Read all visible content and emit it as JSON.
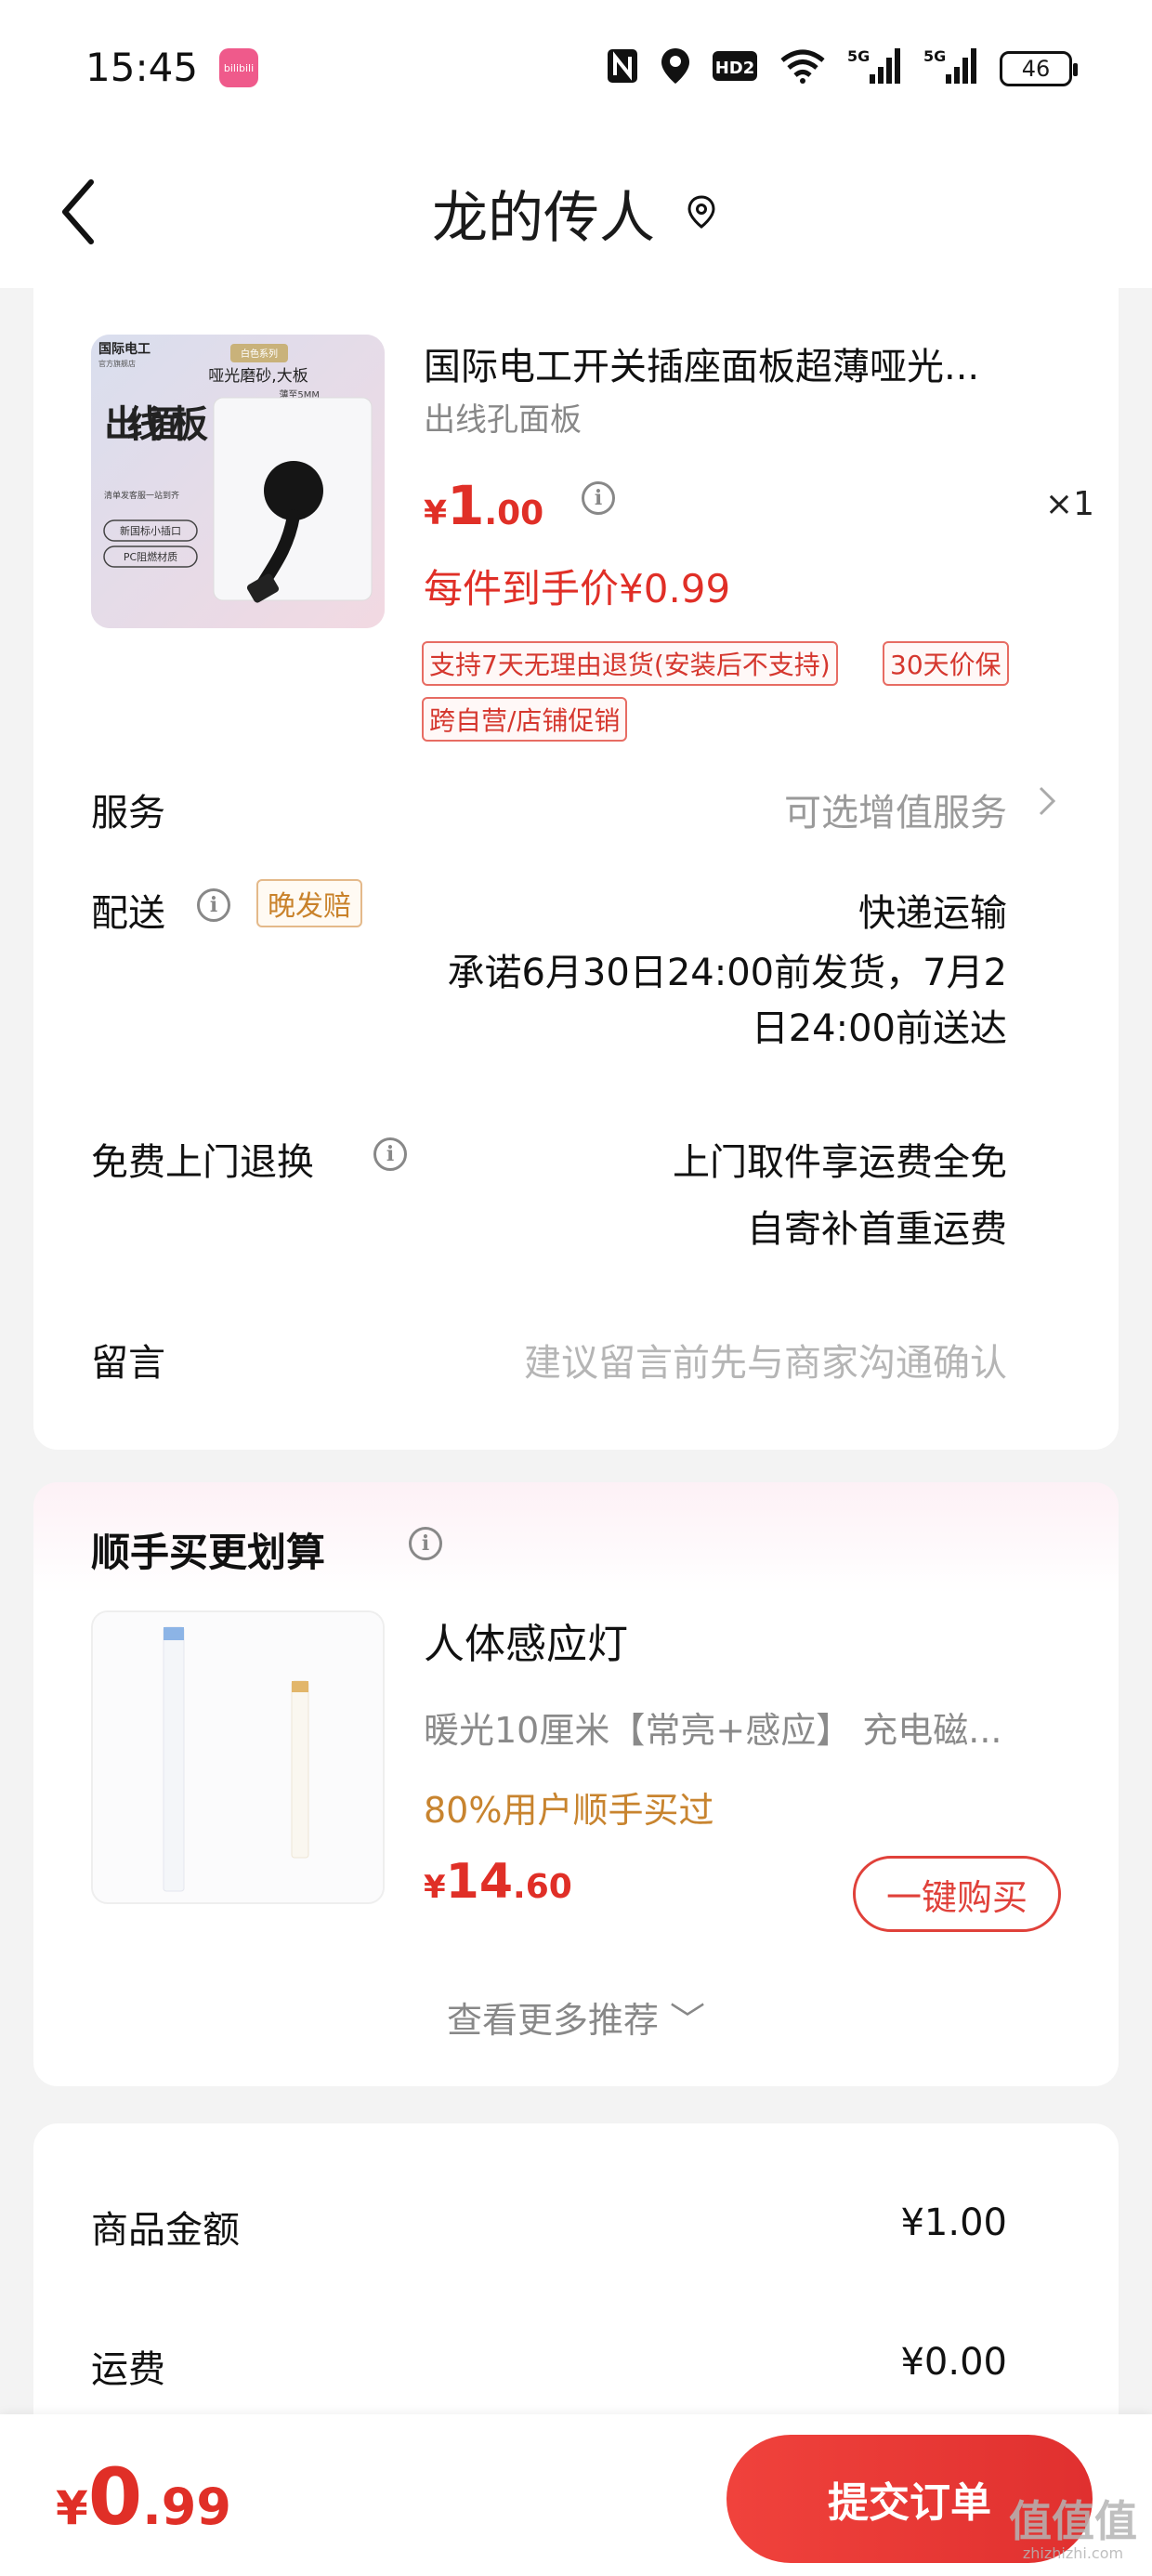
{
  "status_bar": {
    "time": "15:45",
    "app_badge": "bilibili",
    "icons": [
      "nfc-icon",
      "location-icon",
      "hd2-icon",
      "wifi-icon",
      "5g-signal-icon",
      "5g-signal-icon"
    ],
    "hd_label": "HD2",
    "signal1": "5G",
    "signal2": "5G",
    "battery": "46"
  },
  "nav": {
    "title": "龙的传人"
  },
  "product": {
    "image_brand": "国际电工",
    "image_brand_sub": "官方旗舰店",
    "image_series": "白色系列",
    "image_headline": "哑光磨砂,大板",
    "image_thickness": "薄至5MM",
    "image_big_text": "出线面板",
    "image_note": "清单发客服一站到齐",
    "image_badge1": "新国标小插口",
    "image_badge2": "PC阻燃材质",
    "title": "国际电工开关插座面板超薄哑光...",
    "subtitle": "出线孔面板",
    "price_currency": "¥",
    "price_int": "1",
    "price_dec": ".00",
    "quantity": "×1",
    "deal_price": "每件到手价¥0.99",
    "tags": [
      "支持7天无理由退货(安装后不支持)",
      "30天价保",
      "跨自营/店铺促销"
    ]
  },
  "rows": {
    "service_label": "服务",
    "service_value": "可选增值服务",
    "delivery_label": "配送",
    "delivery_tag": "晚发赔",
    "delivery_method": "快递运输",
    "delivery_line1": "承诺6月30日24:00前发货，7月2",
    "delivery_line2": "日24:00前送达",
    "return_label": "免费上门退换",
    "return_line1": "上门取件享运费全免",
    "return_line2": "自寄补首重运费",
    "message_label": "留言",
    "message_placeholder": "建议留言前先与商家沟通确认"
  },
  "recommend": {
    "title": "顺手买更划算",
    "name": "人体感应灯",
    "spec": "暖光10厘米【常亮+感应】  充电磁...",
    "users": "80%用户顺手买过",
    "price_currency": "¥",
    "price_int": "14",
    "price_dec": ".60",
    "buy_label": "一键购买",
    "more_label": "查看更多推荐 ﹀"
  },
  "summary": {
    "goods_label": "商品金额",
    "goods_value": "¥1.00",
    "shipping_label": "运费",
    "shipping_value": "¥0.00"
  },
  "bottom": {
    "total_currency": "¥",
    "total_int": "0",
    "total_dec": ".99",
    "submit_label": "提交订单",
    "watermark": "值值值",
    "watermark_url": "zhizhizhi.com"
  },
  "colors": {
    "accent_red": "#e02f27",
    "orange": "#c8842f",
    "gray_text": "#9a9a9a"
  }
}
